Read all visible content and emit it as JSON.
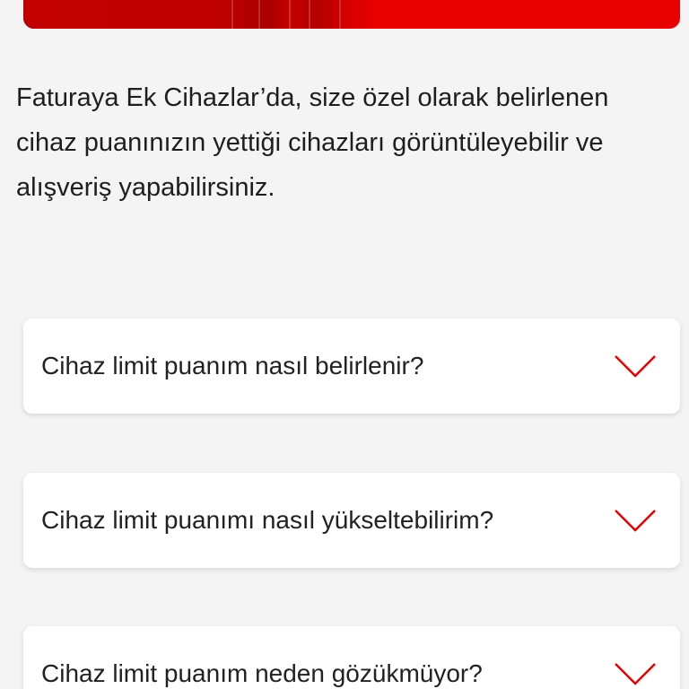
{
  "colors": {
    "accent": "#e60000",
    "background": "#f4f4f4",
    "card": "#ffffff"
  },
  "intro": {
    "text": "Faturaya Ek Cihazlar’da, size özel olarak belirlenen cihaz puanınızın yettiği cihazları görüntüleyebilir ve alışveriş yapabilirsiniz."
  },
  "faq": {
    "items": [
      {
        "question": "Cihaz limit puanım nasıl belirlenir?",
        "icon": "chevron-down-icon"
      },
      {
        "question": "Cihaz limit puanımı nasıl yükseltebilirim?",
        "icon": "chevron-down-icon"
      },
      {
        "question": "Cihaz limit puanım neden gözükmüyor?",
        "icon": "chevron-down-icon"
      }
    ]
  }
}
